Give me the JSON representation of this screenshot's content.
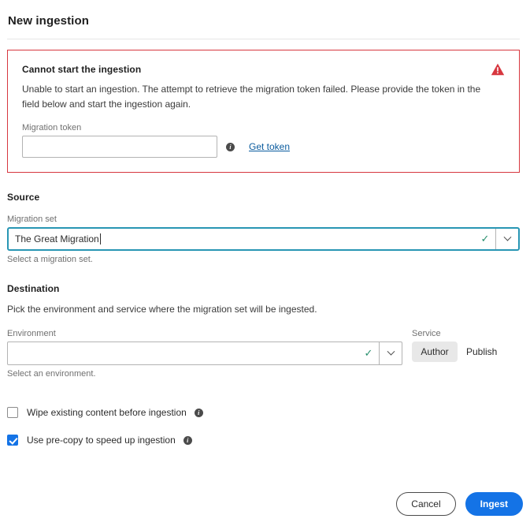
{
  "page": {
    "title": "New ingestion"
  },
  "error": {
    "title": "Cannot start the ingestion",
    "message": "Unable to start an ingestion. The attempt to retrieve the migration token failed. Please provide the token in the field below and start the ingestion again.",
    "icon": "warning-triangle-icon",
    "border_color": "#d7373f",
    "token_field": {
      "label": "Migration token",
      "value": "",
      "placeholder": "",
      "info_icon": "info-icon"
    },
    "get_token_link": "Get token"
  },
  "source": {
    "heading": "Source",
    "migration_set": {
      "label": "Migration set",
      "value": "The Great Migration",
      "help": "Select a migration set.",
      "valid_icon": "checkmark-icon",
      "dropdown_icon": "chevron-down-icon",
      "focus_color": "#2896b4"
    }
  },
  "destination": {
    "heading": "Destination",
    "description": "Pick the environment and service where the migration set will be ingested.",
    "environment": {
      "label": "Environment",
      "value": "",
      "help": "Select an environment.",
      "valid_icon": "checkmark-icon",
      "dropdown_icon": "chevron-down-icon"
    },
    "service": {
      "label": "Service",
      "options": [
        "Author",
        "Publish"
      ],
      "selected": "Author"
    }
  },
  "options": [
    {
      "label": "Wipe existing content before ingestion",
      "checked": false,
      "info_icon": "info-icon"
    },
    {
      "label": "Use pre-copy to speed up ingestion",
      "checked": true,
      "info_icon": "info-icon"
    }
  ],
  "footer": {
    "cancel_label": "Cancel",
    "ingest_label": "Ingest",
    "primary_color": "#1473e6"
  }
}
